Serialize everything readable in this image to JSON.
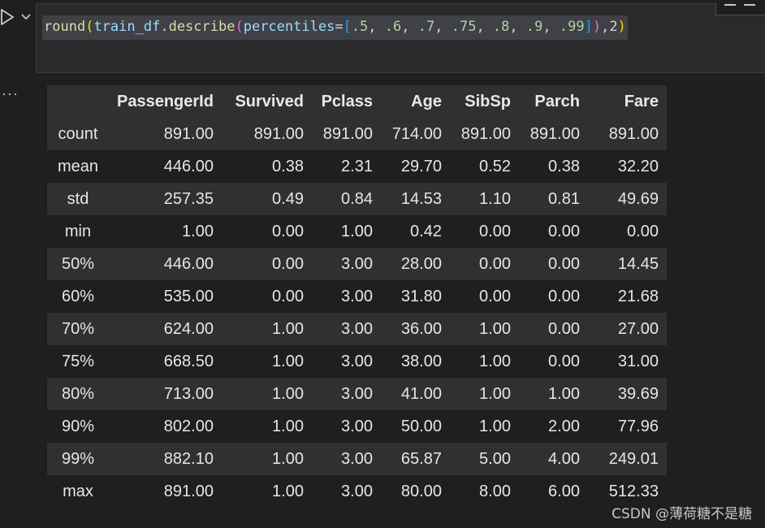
{
  "cell": {
    "code_tokens": [
      {
        "t": "round",
        "c": "fn"
      },
      {
        "t": "(",
        "c": "br1"
      },
      {
        "t": "train_df",
        "c": "var"
      },
      {
        "t": ".",
        "c": "op"
      },
      {
        "t": "describe",
        "c": "fn"
      },
      {
        "t": "(",
        "c": "br2"
      },
      {
        "t": "percentiles",
        "c": "var"
      },
      {
        "t": "=",
        "c": "op"
      },
      {
        "t": "[",
        "c": "br3"
      },
      {
        "t": ".5",
        "c": "num"
      },
      {
        "t": ", ",
        "c": "op"
      },
      {
        "t": ".6",
        "c": "num"
      },
      {
        "t": ", ",
        "c": "op"
      },
      {
        "t": ".7",
        "c": "num"
      },
      {
        "t": ", ",
        "c": "op"
      },
      {
        "t": ".75",
        "c": "num"
      },
      {
        "t": ", ",
        "c": "op"
      },
      {
        "t": ".8",
        "c": "num"
      },
      {
        "t": ", ",
        "c": "op"
      },
      {
        "t": ".9",
        "c": "num"
      },
      {
        "t": ", ",
        "c": "op"
      },
      {
        "t": ".99",
        "c": "num"
      },
      {
        "t": "]",
        "c": "br3"
      },
      {
        "t": ")",
        "c": "br2"
      },
      {
        "t": ",2",
        "c": "op"
      },
      {
        "t": ")",
        "c": "br1"
      }
    ]
  },
  "icons": {
    "run": "play-icon",
    "chevron": "chevron-down-icon",
    "more": "more-horizontal-icon"
  },
  "output": {
    "more_glyph": "···",
    "columns": [
      "PassengerId",
      "Survived",
      "Pclass",
      "Age",
      "SibSp",
      "Parch",
      "Fare"
    ],
    "rows": [
      {
        "label": "count",
        "values": [
          "891.00",
          "891.00",
          "891.00",
          "714.00",
          "891.00",
          "891.00",
          "891.00"
        ]
      },
      {
        "label": "mean",
        "values": [
          "446.00",
          "0.38",
          "2.31",
          "29.70",
          "0.52",
          "0.38",
          "32.20"
        ]
      },
      {
        "label": "std",
        "values": [
          "257.35",
          "0.49",
          "0.84",
          "14.53",
          "1.10",
          "0.81",
          "49.69"
        ]
      },
      {
        "label": "min",
        "values": [
          "1.00",
          "0.00",
          "1.00",
          "0.42",
          "0.00",
          "0.00",
          "0.00"
        ]
      },
      {
        "label": "50%",
        "values": [
          "446.00",
          "0.00",
          "3.00",
          "28.00",
          "0.00",
          "0.00",
          "14.45"
        ]
      },
      {
        "label": "60%",
        "values": [
          "535.00",
          "0.00",
          "3.00",
          "31.80",
          "0.00",
          "0.00",
          "21.68"
        ]
      },
      {
        "label": "70%",
        "values": [
          "624.00",
          "1.00",
          "3.00",
          "36.00",
          "1.00",
          "0.00",
          "27.00"
        ]
      },
      {
        "label": "75%",
        "values": [
          "668.50",
          "1.00",
          "3.00",
          "38.00",
          "1.00",
          "0.00",
          "31.00"
        ]
      },
      {
        "label": "80%",
        "values": [
          "713.00",
          "1.00",
          "3.00",
          "41.00",
          "1.00",
          "1.00",
          "39.69"
        ]
      },
      {
        "label": "90%",
        "values": [
          "802.00",
          "1.00",
          "3.00",
          "50.00",
          "1.00",
          "2.00",
          "77.96"
        ]
      },
      {
        "label": "99%",
        "values": [
          "882.10",
          "1.00",
          "3.00",
          "65.87",
          "5.00",
          "4.00",
          "249.01"
        ]
      },
      {
        "label": "max",
        "values": [
          "891.00",
          "1.00",
          "3.00",
          "80.00",
          "8.00",
          "6.00",
          "512.33"
        ]
      }
    ]
  },
  "watermark": "CSDN @薄荷糖不是糖",
  "colors": {
    "background": "#1f1f1f",
    "cell_background": "#2a2a2a",
    "row_stripe": "#303030",
    "text": "#e6e6e6"
  }
}
